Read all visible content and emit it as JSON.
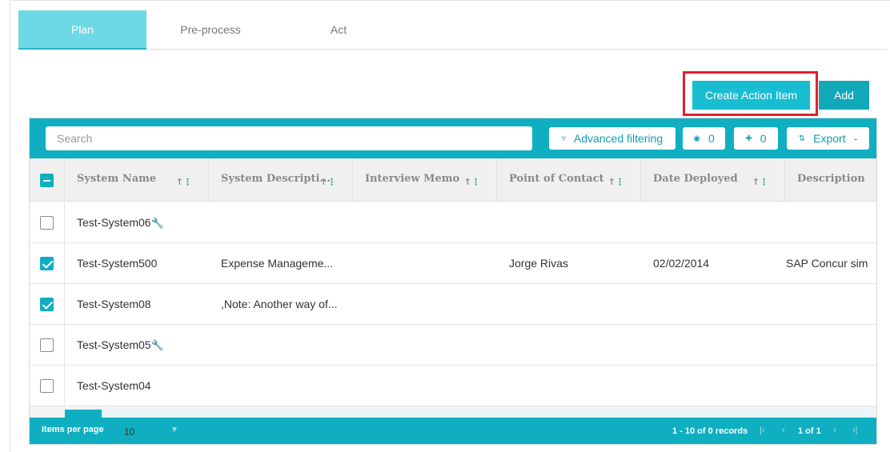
{
  "tabs": [
    {
      "label": "Plan",
      "active": true
    },
    {
      "label": "Pre-process",
      "active": false
    },
    {
      "label": "Act",
      "active": false
    }
  ],
  "actions": {
    "create_label": "Create Action Item",
    "add_label": "Add"
  },
  "toolbar": {
    "search_placeholder": "Search",
    "advanced_filtering_label": "Advanced filtering",
    "visible_count": "0",
    "pinned_count": "0",
    "export_label": "Export",
    "export_dropdown": "-"
  },
  "columns": [
    {
      "label": "System Name"
    },
    {
      "label": "System Descripti..."
    },
    {
      "label": "Interview Memo"
    },
    {
      "label": "Point of Contact"
    },
    {
      "label": "Date Deployed"
    },
    {
      "label": "Description"
    }
  ],
  "rows": [
    {
      "checked": false,
      "system_name": "Test-System06",
      "has_wrench": true,
      "description": "",
      "interview_memo": "",
      "contact": "",
      "date": "",
      "desc2": ""
    },
    {
      "checked": true,
      "system_name": "Test-System500",
      "has_wrench": false,
      "description": "Expense Manageme...",
      "interview_memo": "",
      "contact": "Jorge Rivas",
      "date": "02/02/2014",
      "desc2": "SAP Concur sim"
    },
    {
      "checked": true,
      "system_name": "Test-System08",
      "has_wrench": false,
      "description": ",Note: Another way of...",
      "interview_memo": "",
      "contact": "",
      "date": "",
      "desc2": ""
    },
    {
      "checked": false,
      "system_name": "Test-System05",
      "has_wrench": true,
      "description": "",
      "interview_memo": "",
      "contact": "",
      "date": "",
      "desc2": ""
    },
    {
      "checked": false,
      "system_name": "Test-System04",
      "has_wrench": false,
      "description": "",
      "interview_memo": "",
      "contact": "",
      "date": "",
      "desc2": ""
    }
  ],
  "footer": {
    "items_per_page_label": "Items per page",
    "items_per_page_value": "10",
    "records_label": "1 - 10 of 0 records",
    "page_label": "1 of 1"
  },
  "colors": {
    "accent": "#0fafc1",
    "tab_active": "#6dd8e6",
    "highlight": "#e0202a"
  }
}
